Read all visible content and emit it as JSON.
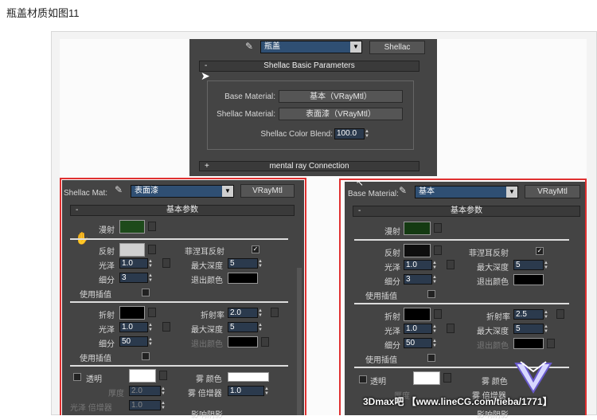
{
  "caption": "瓶盖材质如图11",
  "top_panel": {
    "material_name": "瓶盖",
    "material_type": "Shellac",
    "rollout_title": "Shellac Basic Parameters",
    "base_material_label": "Base Material:",
    "base_material_value": "基本（VRayMtl）",
    "shellac_material_label": "Shellac Material:",
    "shellac_material_value": "表面漆（VRayMtl）",
    "blend_label": "Shellac Color Blend:",
    "blend_value": "100.0",
    "mental_ray_rollout": "mental ray Connection"
  },
  "left_panel": {
    "header_label": "Shellac Mat:",
    "material_name": "表面漆",
    "material_type": "VRayMtl",
    "rollout_title": "基本参数",
    "diffuse_label": "漫射",
    "diffuse_color": "#1d4a1a",
    "reflect_label": "反射",
    "reflect_color": "#d0d0d0",
    "fresnel_label": "菲涅耳反射",
    "gloss_label": "光泽",
    "gloss_value": "1.0",
    "max_depth_label": "最大深度",
    "max_depth_value": "5",
    "subdiv_label": "细分",
    "subdiv_value": "3",
    "exit_color_label": "退出颜色",
    "interp_label": "使用插值",
    "refract_label": "折射",
    "ior_label": "折射率",
    "ior_value": "2.0",
    "refr_gloss_value": "1.0",
    "refr_depth_value": "5",
    "refr_subdiv_value": "50",
    "refr_exit_label": "退出颜色",
    "refr_interp_label": "使用插值",
    "transparent_label": "透明",
    "fog_color_label": "雾 颜色",
    "thickness_label": "厚度",
    "thickness_value": "2.0",
    "fog_mult_label": "雾 倍增器",
    "fog_mult_value": "1.0",
    "light_mult_label": "光泽 倍增器",
    "light_mult_value": "1.0",
    "shadow_label": "影响阴影"
  },
  "right_panel": {
    "header_label": "Base Material:",
    "material_name": "基本",
    "material_type": "VRayMtl",
    "rollout_title": "基本参数",
    "diffuse_label": "漫射",
    "diffuse_color": "#143a12",
    "reflect_label": "反射",
    "reflect_color": "#0e0e0e",
    "fresnel_label": "菲涅耳反射",
    "gloss_label": "光泽",
    "gloss_value": "1.0",
    "max_depth_label": "最大深度",
    "max_depth_value": "5",
    "subdiv_label": "细分",
    "subdiv_value": "3",
    "exit_color_label": "退出颜色",
    "interp_label": "使用插值",
    "refract_label": "折射",
    "ior_label": "折射率",
    "ior_value": "2.5",
    "refr_gloss_value": "1.0",
    "refr_depth_value": "5",
    "refr_subdiv_value": "50",
    "refr_exit_label": "退出颜色",
    "refr_interp_label": "使用插值",
    "transparent_label": "透明",
    "fog_color_label": "雾 颜色",
    "thickness_label": "厚度",
    "fog_mult_label": "雾 倍增器",
    "shadow_label": "影响阴影"
  },
  "watermark": "3Dmax吧 【www.lineCG.com/tieba/1771】",
  "accent_red": "#e03030"
}
